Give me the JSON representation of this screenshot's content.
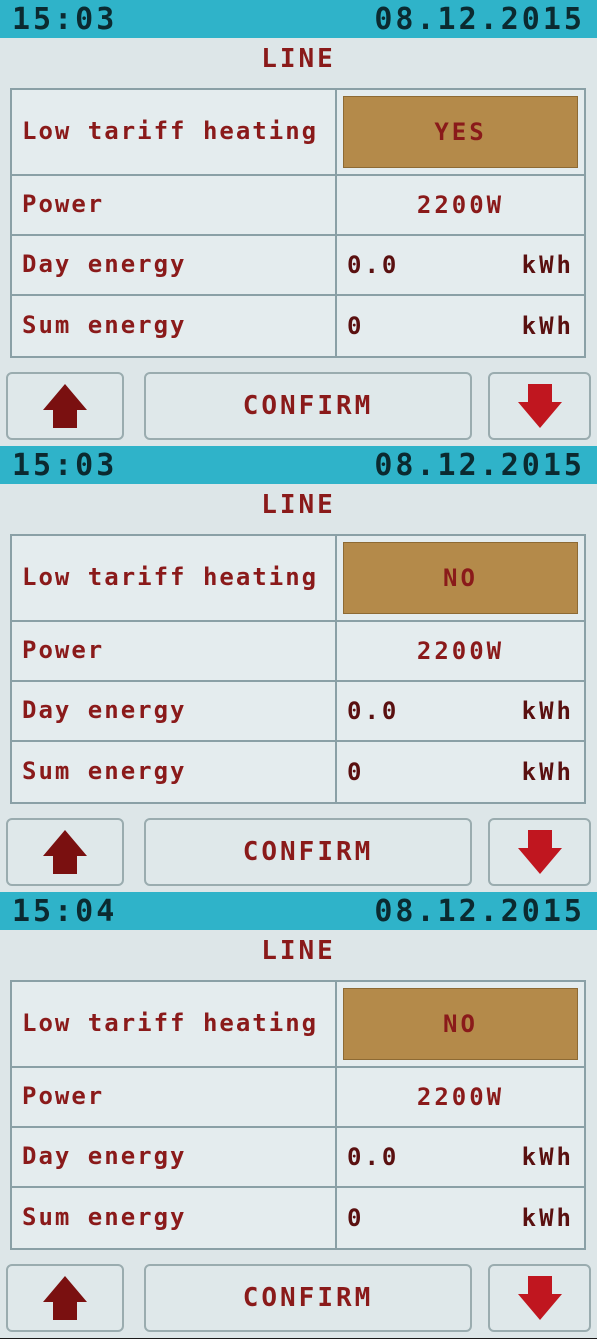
{
  "screens": [
    {
      "time": "15:03",
      "date": "08.12.2015",
      "title": "LINE",
      "rows": [
        {
          "label": "Low tariff heating",
          "value": "YES"
        },
        {
          "label": "Power",
          "value": "2200W"
        },
        {
          "label": "Day energy",
          "value": "0.0",
          "unit": "kWh"
        },
        {
          "label": "Sum energy",
          "value": "0",
          "unit": "kWh"
        }
      ],
      "buttons": {
        "confirm": "CONFIRM"
      }
    },
    {
      "time": "15:03",
      "date": "08.12.2015",
      "title": "LINE",
      "rows": [
        {
          "label": "Low tariff heating",
          "value": "NO"
        },
        {
          "label": "Power",
          "value": "2200W"
        },
        {
          "label": "Day energy",
          "value": "0.0",
          "unit": "kWh"
        },
        {
          "label": "Sum energy",
          "value": "0",
          "unit": "kWh"
        }
      ],
      "buttons": {
        "confirm": "CONFIRM"
      }
    },
    {
      "time": "15:04",
      "date": "08.12.2015",
      "title": "LINE",
      "rows": [
        {
          "label": "Low tariff heating",
          "value": "NO"
        },
        {
          "label": "Power",
          "value": "2200W"
        },
        {
          "label": "Day energy",
          "value": "0.0",
          "unit": "kWh"
        },
        {
          "label": "Sum energy",
          "value": "0",
          "unit": "kWh"
        }
      ],
      "buttons": {
        "confirm": "CONFIRM"
      }
    }
  ],
  "colors": {
    "header_bg": "#2fb3c9",
    "text_red": "#8a1a1a",
    "toggle_bg": "#b48a4a",
    "arrow_red": "#c0161f",
    "arrow_dark": "#7a1010"
  },
  "icons": {
    "up": "arrow-up-icon",
    "down": "arrow-down-icon"
  }
}
